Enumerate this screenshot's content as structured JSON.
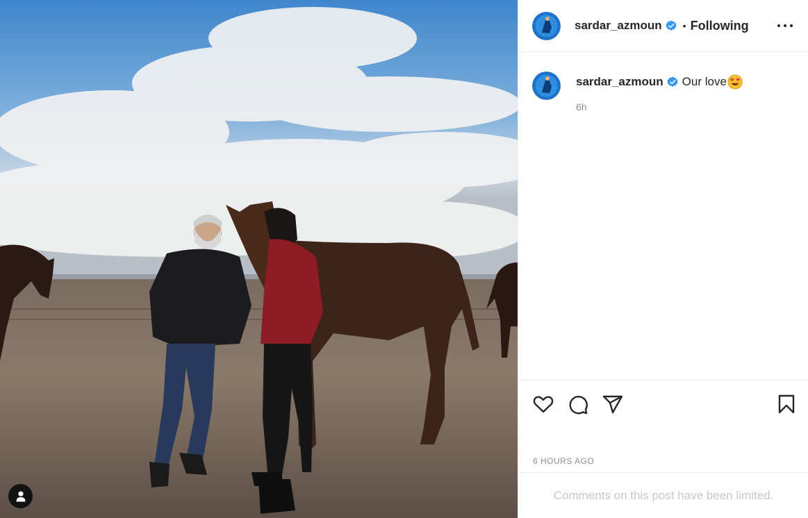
{
  "post": {
    "author": "sardar_azmoun",
    "follow_state": "Following",
    "separator": "•",
    "caption": "Our love",
    "caption_time": "6h",
    "posted_ago": "6 HOURS AGO",
    "comments_notice": "Comments on this post have been limited."
  },
  "icons": {
    "verified": "verified-badge-icon",
    "more": "more-options-icon",
    "like": "heart-icon",
    "comment": "comment-bubble-icon",
    "share": "paper-plane-icon",
    "save": "bookmark-icon",
    "user_tag": "user-tag-icon",
    "emoji": "heart-eyes-emoji"
  },
  "colors": {
    "verified_blue": "#3897f0",
    "text": "#262626",
    "muted": "#8e8e8e",
    "border": "#efefef",
    "disabled": "#c7c7c7"
  }
}
